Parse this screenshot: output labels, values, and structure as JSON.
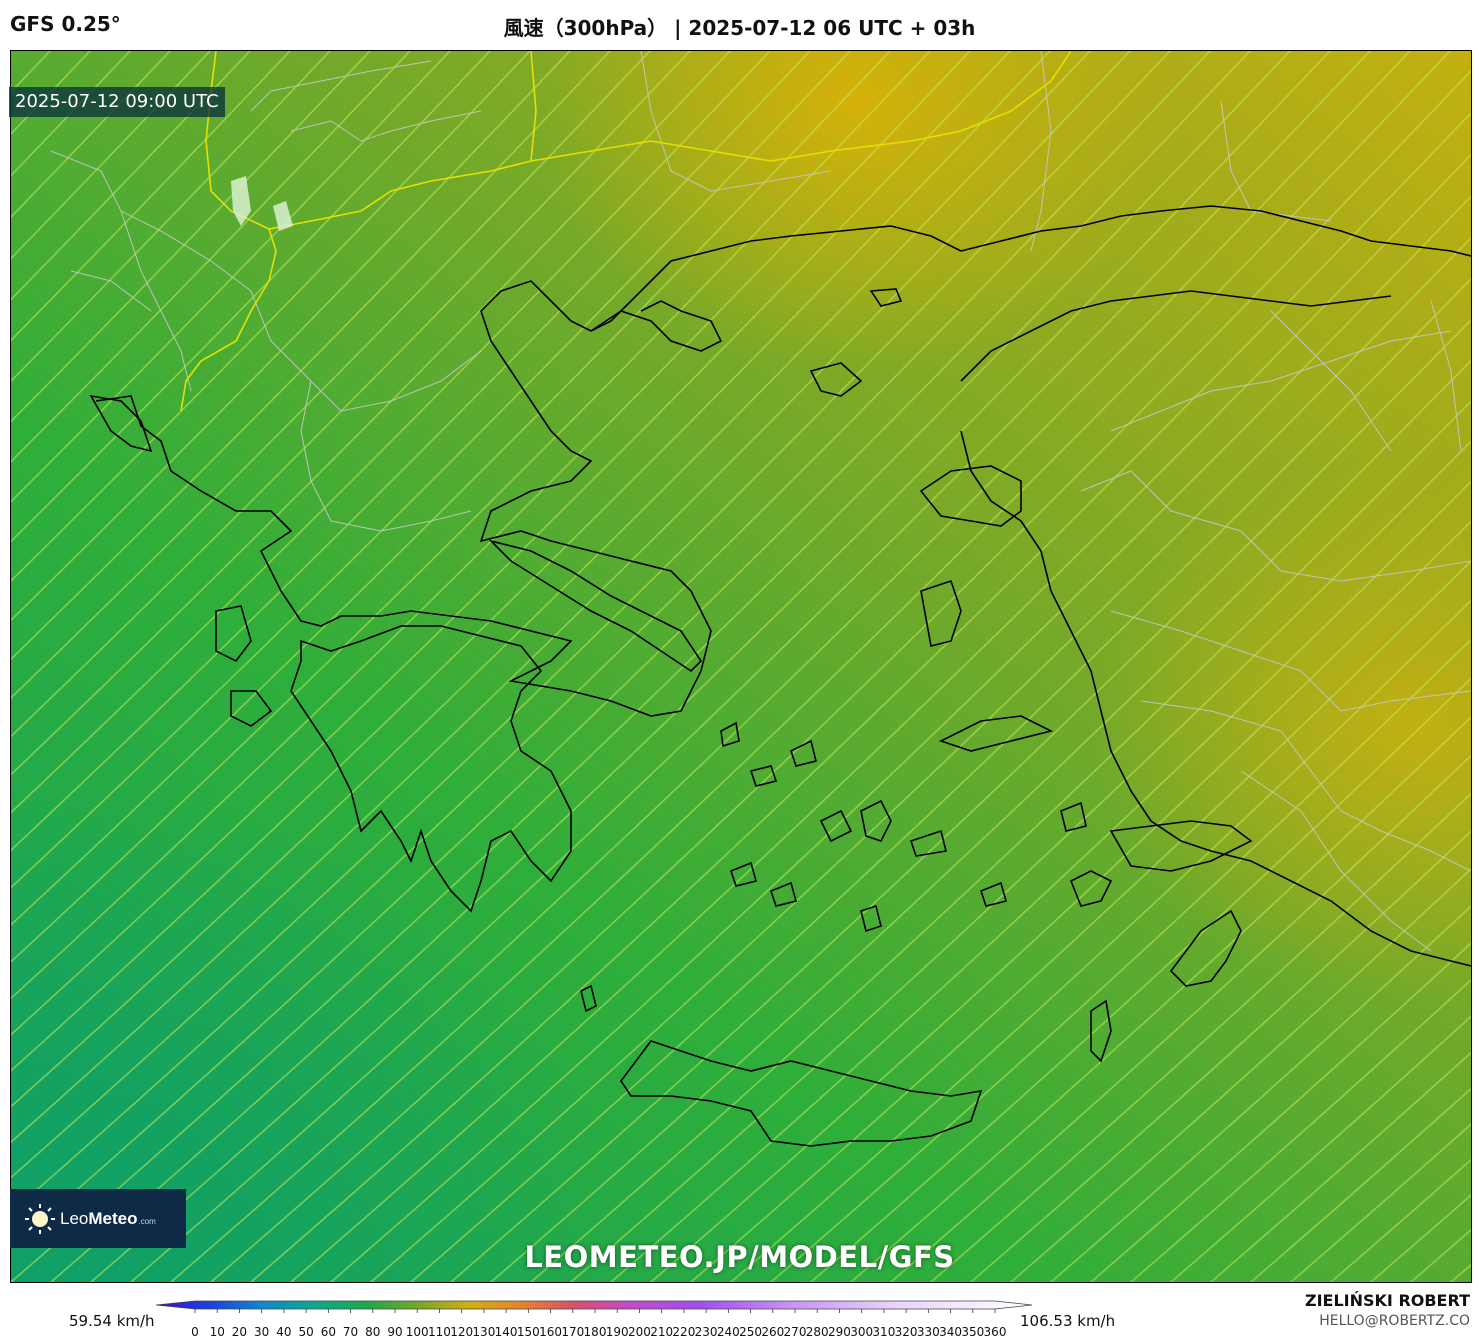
{
  "header": {
    "model": "GFS 0.25°",
    "title": "風速（300hPa） | 2025-07-12 06 UTC + 03h"
  },
  "map": {
    "valid_time": "2025-07-12 09:00 UTC",
    "region": "Greece / Aegean Sea",
    "field": "wind speed 300hPa",
    "colors": {
      "low": "#16a860",
      "mid": "#62a52e",
      "high": "#cdb10c",
      "coastline": "#000000",
      "borders": "#bdbdbd",
      "streamlines": "#c6ec5a"
    }
  },
  "branding": {
    "logo_text_light": "Leo",
    "logo_text_bold": "Meteo",
    "logo_suffix": ".com",
    "watermark": "LEOMETEO.JP/MODEL/GFS"
  },
  "legend": {
    "min_label": "59.54 km/h",
    "max_label": "106.53 km/h",
    "ticks": [
      "0",
      "10",
      "20",
      "30",
      "40",
      "50",
      "60",
      "70",
      "80",
      "90",
      "100",
      "110",
      "120",
      "130",
      "140",
      "150",
      "160",
      "170",
      "180",
      "190",
      "200",
      "210",
      "220",
      "230",
      "240",
      "250",
      "260",
      "270",
      "280",
      "290",
      "300",
      "310",
      "320",
      "330",
      "340",
      "350",
      "360"
    ]
  },
  "credit": {
    "author": "ZIELIŃSKI ROBERT",
    "email": "HELLO@ROBERTZ.CO"
  }
}
